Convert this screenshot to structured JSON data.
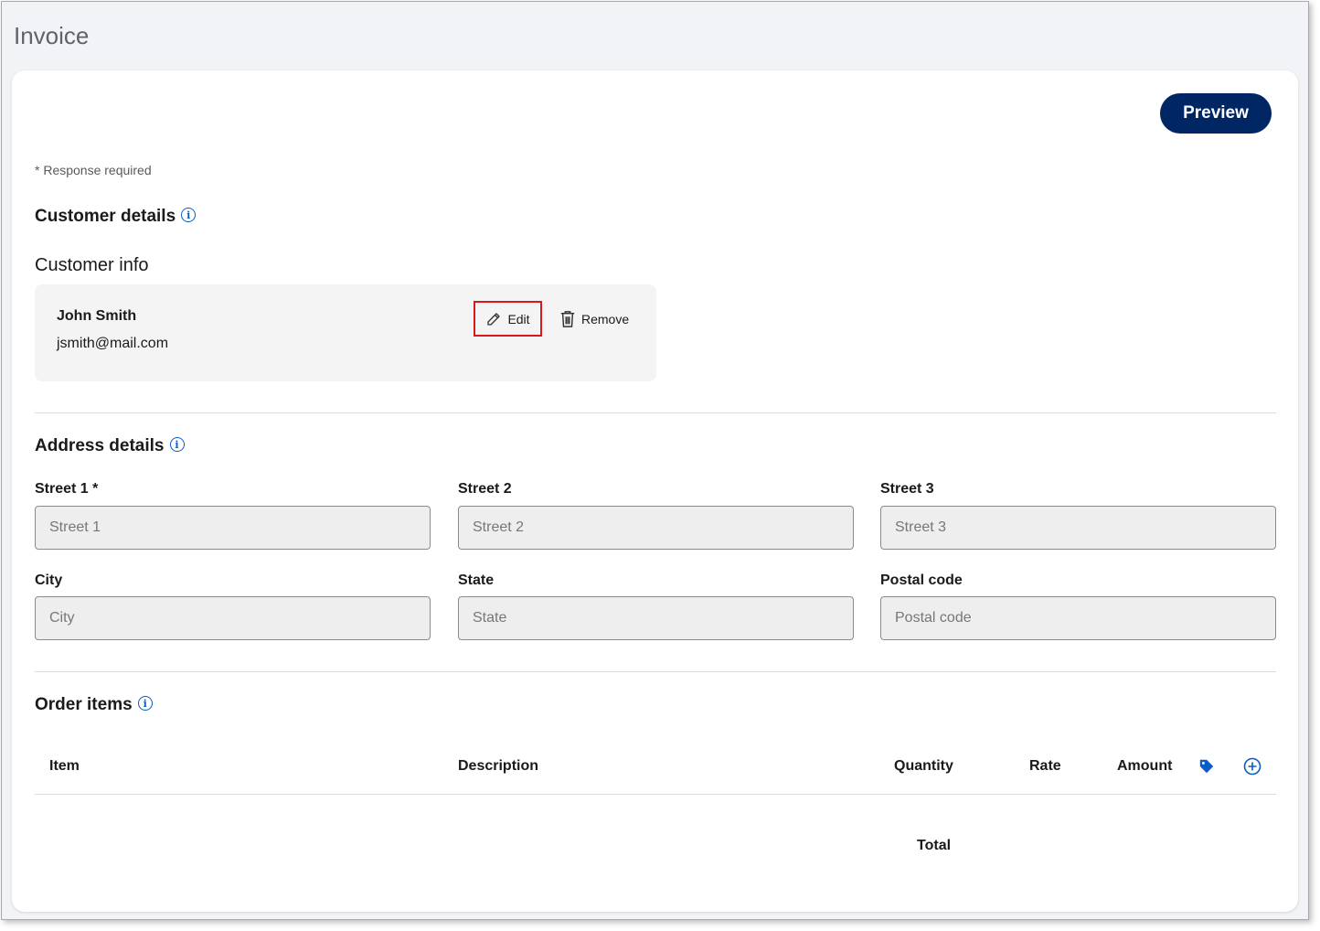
{
  "page": {
    "title": "Invoice"
  },
  "toolbar": {
    "preview_label": "Preview"
  },
  "form": {
    "required_note": "* Response required"
  },
  "customer": {
    "section_title": "Customer details",
    "info_title": "Customer info",
    "name": "John Smith",
    "email": "jsmith@mail.com",
    "edit_label": "Edit",
    "remove_label": "Remove"
  },
  "address": {
    "section_title": "Address details",
    "fields": [
      {
        "label": "Street 1 *",
        "placeholder": "Street 1",
        "value": ""
      },
      {
        "label": "Street 2",
        "placeholder": "Street 2",
        "value": ""
      },
      {
        "label": "Street 3",
        "placeholder": "Street 3",
        "value": ""
      },
      {
        "label": "City",
        "placeholder": "City",
        "value": ""
      },
      {
        "label": "State",
        "placeholder": "State",
        "value": ""
      },
      {
        "label": "Postal code",
        "placeholder": "Postal code",
        "value": ""
      }
    ]
  },
  "order": {
    "section_title": "Order items",
    "columns": {
      "item": "Item",
      "description": "Description",
      "quantity": "Quantity",
      "rate": "Rate",
      "amount": "Amount"
    },
    "total_label": "Total",
    "icons": {
      "tag": "tag-icon",
      "add": "plus-circle-icon"
    }
  },
  "colors": {
    "primary": "#002663",
    "accent": "#0a5cc7",
    "highlight": "#d7191c"
  }
}
